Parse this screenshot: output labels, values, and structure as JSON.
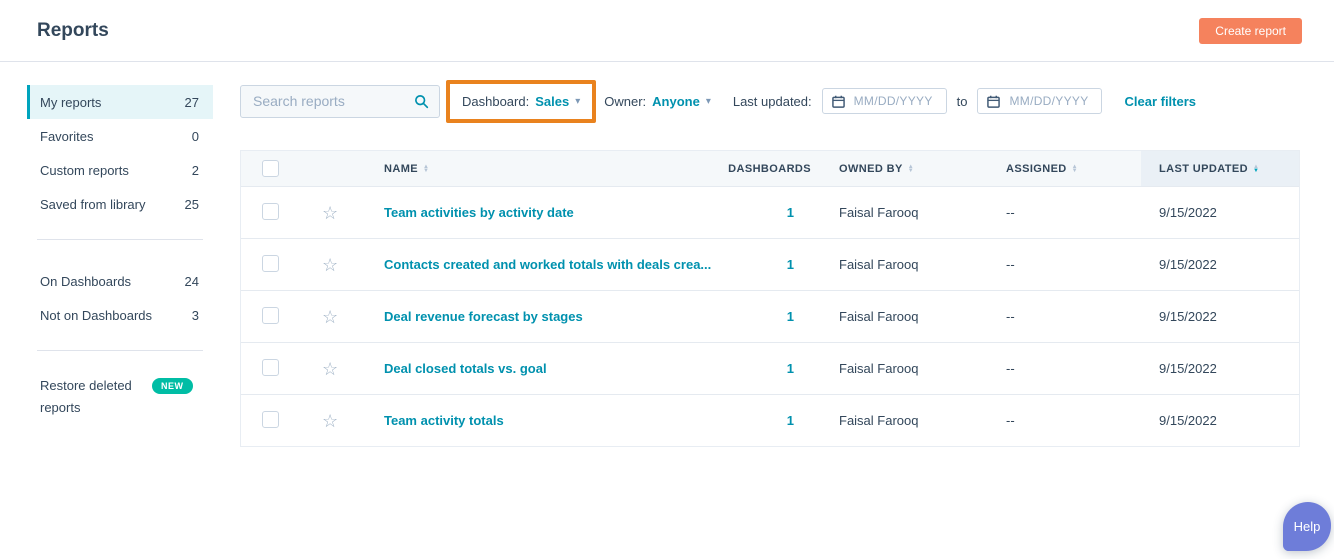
{
  "page": {
    "title": "Reports"
  },
  "header": {
    "create_button_label": "Create report"
  },
  "sidebar": {
    "items": [
      {
        "label": "My reports",
        "count": "27"
      },
      {
        "label": "Favorites",
        "count": "0"
      },
      {
        "label": "Custom reports",
        "count": "2"
      },
      {
        "label": "Saved from library",
        "count": "25"
      },
      {
        "label": "On Dashboards",
        "count": "24"
      },
      {
        "label": "Not on Dashboards",
        "count": "3"
      }
    ],
    "restore": {
      "label": "Restore deleted reports",
      "badge": "NEW"
    }
  },
  "filters": {
    "search_placeholder": "Search reports",
    "dashboard_label": "Dashboard:",
    "dashboard_value": "Sales",
    "owner_label": "Owner:",
    "owner_value": "Anyone",
    "last_updated_label": "Last updated:",
    "date_placeholder": "MM/DD/YYYY",
    "to_label": "to",
    "clear_filters_label": "Clear filters"
  },
  "table": {
    "headers": {
      "name": "NAME",
      "dashboards": "DASHBOARDS",
      "owned_by": "OWNED BY",
      "assigned": "ASSIGNED",
      "last_updated": "LAST UPDATED"
    },
    "rows": [
      {
        "name": "Team activities by activity date",
        "dashboards": "1",
        "owned_by": "Faisal Farooq",
        "assigned": "--",
        "last_updated": "9/15/2022"
      },
      {
        "name": "Contacts created and worked totals with deals crea...",
        "dashboards": "1",
        "owned_by": "Faisal Farooq",
        "assigned": "--",
        "last_updated": "9/15/2022"
      },
      {
        "name": "Deal revenue forecast by stages",
        "dashboards": "1",
        "owned_by": "Faisal Farooq",
        "assigned": "--",
        "last_updated": "9/15/2022"
      },
      {
        "name": "Deal closed totals vs. goal",
        "dashboards": "1",
        "owned_by": "Faisal Farooq",
        "assigned": "--",
        "last_updated": "9/15/2022"
      },
      {
        "name": "Team activity totals",
        "dashboards": "1",
        "owned_by": "Faisal Farooq",
        "assigned": "--",
        "last_updated": "9/15/2022"
      }
    ]
  },
  "help": {
    "label": "Help"
  },
  "icons": {
    "caret_down": "▾",
    "sort_asc": "▲",
    "sort_desc": "▼",
    "star_outline": "☆",
    "search": "magnifier-svg",
    "calendar": "calendar-svg"
  },
  "colors": {
    "accent_teal": "#0091ae",
    "selected_bar": "#00a4bd",
    "selected_bg": "#e5f5f8",
    "create_button": "#f5825d",
    "annotation_orange": "#e9821e",
    "new_badge": "#00bda5",
    "header_row_bg": "#f5f8fa",
    "sorted_col_bg": "#eaf0f6",
    "help_beacon": "#6e7dd9",
    "text_dark": "#33475b",
    "placeholder": "#99acc2"
  }
}
